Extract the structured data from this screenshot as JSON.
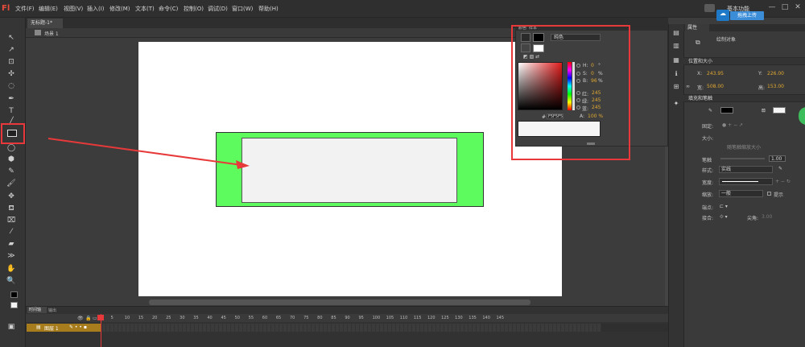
{
  "app": {
    "logo_glyph": "Fl"
  },
  "menu": {
    "items": [
      "文件(F)",
      "编辑(E)",
      "视图(V)",
      "插入(I)",
      "修改(M)",
      "文本(T)",
      "命令(C)",
      "控制(O)",
      "调试(D)",
      "窗口(W)",
      "帮助(H)"
    ],
    "workspace_label": "基本功能",
    "upload_label": "拖拽上传",
    "window_controls": [
      "—",
      "□",
      "✕"
    ]
  },
  "document": {
    "tab_label": "无标题-1*",
    "scene_label": "场景 1"
  },
  "colors": {
    "accent_red": "#e8393a",
    "stage_bg": "#ffffff",
    "green_rect_fill": "#5dfb5d",
    "white_rect_fill": "#f2f2f2",
    "stroke_color": "#000000",
    "fill_color": "#f5f5f5",
    "timeline_layer": "#a67c1c"
  },
  "color_panel": {
    "tabs": [
      "颜色",
      "样本"
    ],
    "type_select": "纯色",
    "hsb": [
      {
        "label": "H:",
        "value": "0",
        "unit": "°"
      },
      {
        "label": "S:",
        "value": "0",
        "unit": "%"
      },
      {
        "label": "B:",
        "value": "96",
        "unit": "%"
      }
    ],
    "rgb": [
      {
        "label": "红:",
        "value": "245"
      },
      {
        "label": "绿:",
        "value": "245"
      },
      {
        "label": "蓝:",
        "value": "245"
      }
    ],
    "hex_prefix": "#",
    "hex": "F5F5F5",
    "alpha_label": "A:",
    "alpha_value": "100 %"
  },
  "properties": {
    "tabs": [
      "属性"
    ],
    "object_label": "绘制对象",
    "sections": {
      "position_size": "位置和大小",
      "fill_stroke": "填充和笔触"
    },
    "x_label": "X:",
    "x_value": "243.95",
    "y_label": "Y:",
    "y_value": "226.00",
    "w_label": "宽:",
    "w_value": "508.00",
    "h_label": "高:",
    "h_value": "153.00",
    "fixed_label": "固定:",
    "size_label": "大小:",
    "scale_size_label": "随笔触缩放大小",
    "stroke_label": "笔触",
    "stroke_value": "1.00",
    "style_label": "样式:",
    "style_value": "实线",
    "width_label": "宽度:",
    "scale_label": "缩放:",
    "scale_value": "一般",
    "hint_label": "提示",
    "cap_label": "端点:",
    "join_label": "接合:",
    "miter_label": "尖角:",
    "miter_value": "3.00"
  },
  "timeline": {
    "tabs": [
      "时间轴",
      "输出"
    ],
    "ruler_numbers": [
      "1",
      "5",
      "10",
      "15",
      "20",
      "25",
      "30",
      "35",
      "40",
      "45",
      "50",
      "55",
      "60",
      "65",
      "70",
      "75",
      "80",
      "85",
      "90",
      "95",
      "100",
      "105",
      "110",
      "115",
      "120",
      "125",
      "130",
      "135",
      "140",
      "145"
    ],
    "layer_name": "图层 1"
  }
}
